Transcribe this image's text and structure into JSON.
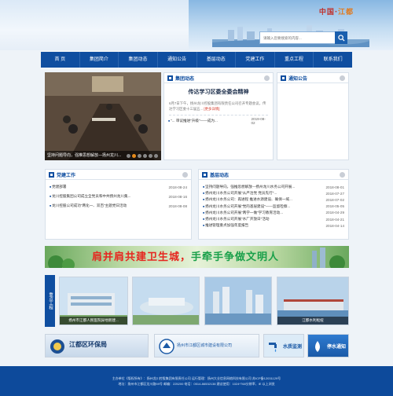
{
  "header": {
    "brand_a": "中国·",
    "brand_b": "江都",
    "search_placeholder": "请输入您要搜索的内容..."
  },
  "nav": [
    "首 页",
    "集团简介",
    "集团动态",
    "通知公告",
    "基层动态",
    "党建工作",
    "重点工程",
    "联系我们"
  ],
  "slideshow": {
    "caption": "坚持问题导向，强推思想解放—扬州龙川...",
    "dots": 6,
    "active_dot": 1
  },
  "group_news": {
    "title": "集团动态",
    "headline": "传达学习区委全委会精神",
    "summary": "6月7日下午，扬州龙川控股集团有限责任公司召开专题会议，传达学习区委十三届五...",
    "more": "[更多详情]",
    "items": [
      {
        "text": "\"... 审议推进\"升级\"——成为...",
        "date": "2019-08-02"
      }
    ]
  },
  "notices": {
    "title": "通知公告"
  },
  "party": {
    "title": "党建工作",
    "items": [
      {
        "text": "党建部署",
        "date": "2018-08-24"
      },
      {
        "text": "龙川控股集团公司成立全党员和中共扬州龙川集...",
        "date": "2018-08-16"
      },
      {
        "text": "龙川控股公司成功\"两化一、双百\"主题党日活动",
        "date": "2018-08-08"
      }
    ]
  },
  "grassroots": {
    "title": "基层动态",
    "items": [
      {
        "text": "坚持问题导向，强推思想解放—扬州龙川水务公司开展...",
        "date": "2018-08-01"
      },
      {
        "text": "扬州龙川水务公司开展\"从严治党 党员先行\"...",
        "date": "2018-07-27"
      },
      {
        "text": "扬州龙川水务公司：再进程 推进水源建设、确保一域...",
        "date": "2018-07-02"
      },
      {
        "text": "扬州龙川水务公司开展\"党的基层建设\"——监督检察...",
        "date": "2018-05-05"
      },
      {
        "text": "扬州龙川水务公司开展\"两学一做\"学习教育活动...",
        "date": "2018-04-29"
      },
      {
        "text": "扬州龙川水务公司开展\"水厂开放日\"活动",
        "date": "2018-04-21"
      },
      {
        "text": "推进管理重点加强年度报告",
        "date": "2018-04-14"
      }
    ]
  },
  "banner": {
    "text_a": "肩并肩共建卫生城，",
    "text_b": "手牵手争做文明人"
  },
  "projects": {
    "label": "重点工程",
    "items": [
      "扬州市江都人民医院异地新建...",
      "",
      "",
      "江都水利枢纽"
    ]
  },
  "links": [
    {
      "title": "江都区环保局"
    },
    {
      "title": "扬州市江都区城市建设有限公司"
    },
    {
      "title": "水质监测"
    },
    {
      "title": "停水通知"
    }
  ],
  "footer": {
    "line1": "主办单位《版权所有》：扬州龙川控股集团有限责任公司  运行管理：扬州大业信息网络科技有限公司  苏ICP备12031129号",
    "line2": "地址：扬州市江都区龙川路59号 邮编：225200 电话：0514-86532138 建议使用：1024*768分辨率、IE 以上浏览"
  },
  "colors": {
    "nav": "#0f4ea0",
    "footer": "#0d4a9b",
    "accent_red": "#e6261f",
    "accent_green": "#1aa04a"
  }
}
